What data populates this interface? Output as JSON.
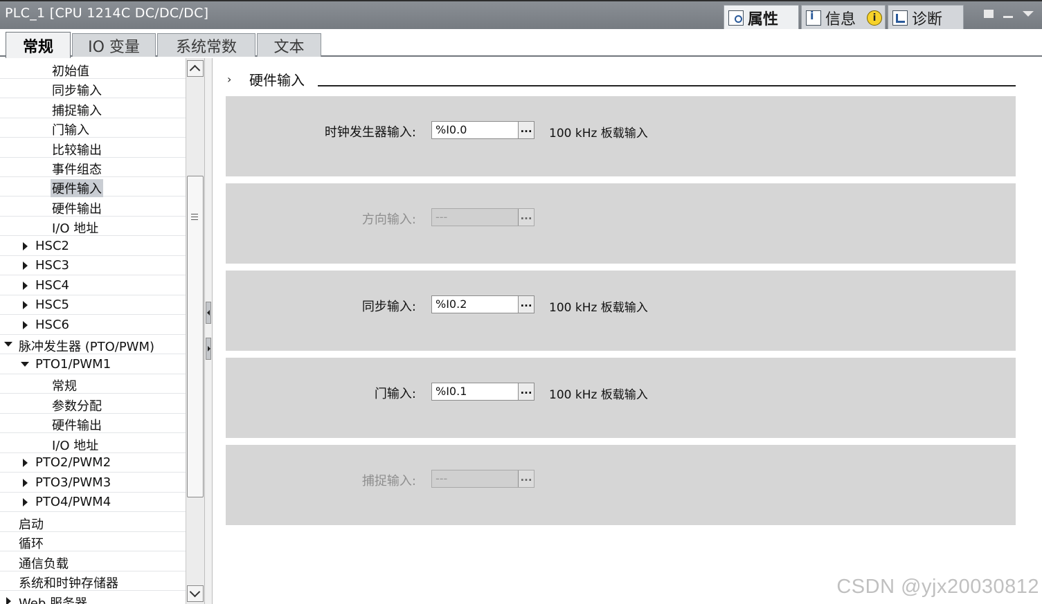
{
  "window": {
    "title": "PLC_1 [CPU 1214C DC/DC/DC]"
  },
  "panel_tabs": [
    {
      "label": "属性",
      "icon": "properties-icon"
    },
    {
      "label": "信息",
      "icon": "info-icon"
    },
    {
      "label": "诊断",
      "icon": "diagnostics-icon"
    }
  ],
  "info_badge": "i",
  "tabs": [
    "常规",
    "IO 变量",
    "系统常数",
    "文本"
  ],
  "tree": {
    "items": [
      {
        "label": "初始值"
      },
      {
        "label": "同步输入"
      },
      {
        "label": "捕捉输入"
      },
      {
        "label": "门输入"
      },
      {
        "label": "比较输出"
      },
      {
        "label": "事件组态"
      },
      {
        "label": "硬件输入"
      },
      {
        "label": "硬件输出"
      },
      {
        "label": "I/O 地址"
      },
      {
        "label": "HSC2"
      },
      {
        "label": "HSC3"
      },
      {
        "label": "HSC4"
      },
      {
        "label": "HSC5"
      },
      {
        "label": "HSC6"
      },
      {
        "label": "脉冲发生器 (PTO/PWM)"
      },
      {
        "label": "PTO1/PWM1"
      },
      {
        "label": "常规"
      },
      {
        "label": "参数分配"
      },
      {
        "label": "硬件输出"
      },
      {
        "label": "I/O 地址"
      },
      {
        "label": "PTO2/PWM2"
      },
      {
        "label": "PTO3/PWM3"
      },
      {
        "label": "PTO4/PWM4"
      },
      {
        "label": "启动"
      },
      {
        "label": "循环"
      },
      {
        "label": "通信负载"
      },
      {
        "label": "系统和时钟存储器"
      },
      {
        "label": "Web 服务器"
      }
    ],
    "selected": "硬件输入"
  },
  "section": {
    "title": "硬件输入"
  },
  "fields": [
    {
      "label": "时钟发生器输入:",
      "value": "%I0.0",
      "button": "...",
      "note": "100 kHz 板载输入",
      "enabled": true
    },
    {
      "label": "方向输入:",
      "value": "---",
      "button": "...",
      "note": "",
      "enabled": false
    },
    {
      "label": "同步输入:",
      "value": "%I0.2",
      "button": "...",
      "note": "100 kHz 板载输入",
      "enabled": true
    },
    {
      "label": "门输入:",
      "value": "%I0.1",
      "button": "...",
      "note": "100 kHz 板载输入",
      "enabled": true
    },
    {
      "label": "捕捉输入:",
      "value": "---",
      "button": "...",
      "note": "",
      "enabled": false
    }
  ],
  "watermark": "CSDN @yjx20030812"
}
